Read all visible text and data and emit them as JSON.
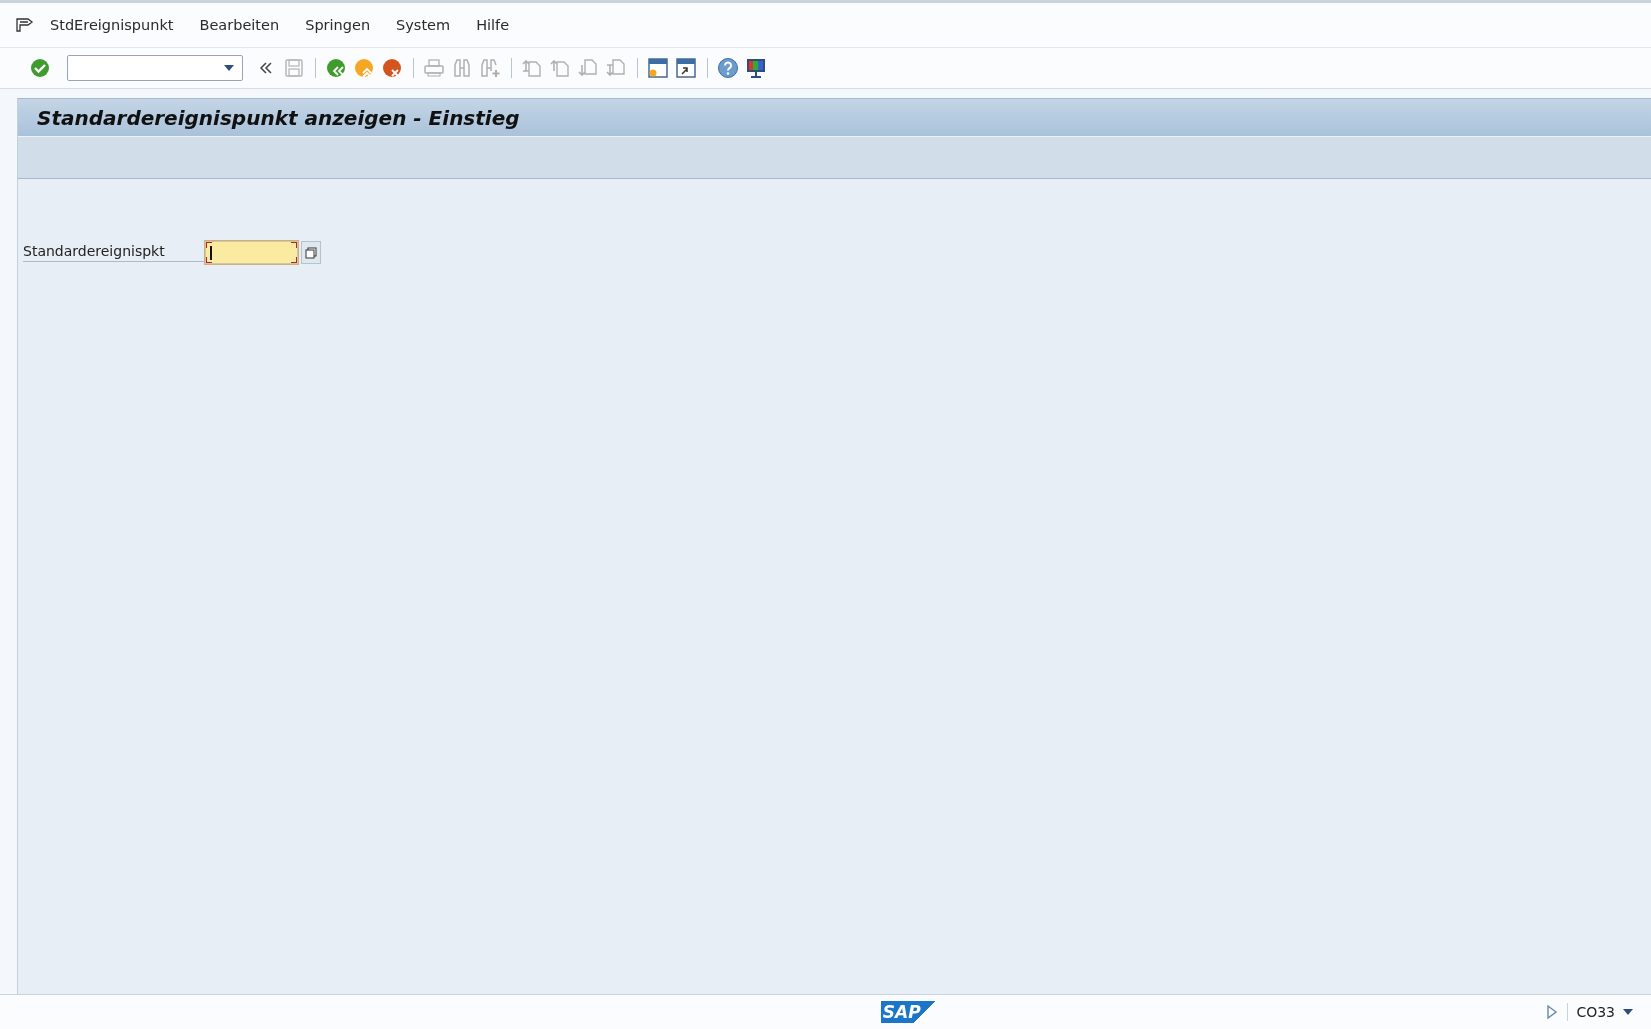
{
  "menu_bar": {
    "items": [
      {
        "label": "StdEreignispunkt"
      },
      {
        "label": "Bearbeiten"
      },
      {
        "label": "Springen"
      },
      {
        "label": "System"
      },
      {
        "label": "Hilfe"
      }
    ]
  },
  "toolbar": {
    "items": [
      {
        "kind": "enter",
        "disabled": false
      },
      {
        "kind": "command-field"
      },
      {
        "kind": "collapse",
        "disabled": false
      },
      {
        "kind": "save",
        "disabled": true
      },
      {
        "kind": "separator"
      },
      {
        "kind": "back",
        "disabled": false
      },
      {
        "kind": "exit",
        "disabled": false
      },
      {
        "kind": "cancel",
        "disabled": false
      },
      {
        "kind": "separator"
      },
      {
        "kind": "print",
        "disabled": true
      },
      {
        "kind": "find",
        "disabled": true
      },
      {
        "kind": "find-next",
        "disabled": true
      },
      {
        "kind": "separator"
      },
      {
        "kind": "first-page",
        "disabled": true
      },
      {
        "kind": "previous-page",
        "disabled": true
      },
      {
        "kind": "next-page",
        "disabled": true
      },
      {
        "kind": "last-page",
        "disabled": true
      },
      {
        "kind": "separator"
      },
      {
        "kind": "new-session",
        "disabled": false
      },
      {
        "kind": "shortcut",
        "disabled": false
      },
      {
        "kind": "separator"
      },
      {
        "kind": "help",
        "disabled": false
      },
      {
        "kind": "layout",
        "disabled": false
      }
    ]
  },
  "screen": {
    "title": "Standardereignispunkt anzeigen - Einstieg",
    "fields": [
      {
        "label": "Standardereignispkt",
        "required": true,
        "focused": true
      }
    ]
  },
  "status_bar": {
    "logo": "SAP",
    "transaction": "CO33"
  }
}
